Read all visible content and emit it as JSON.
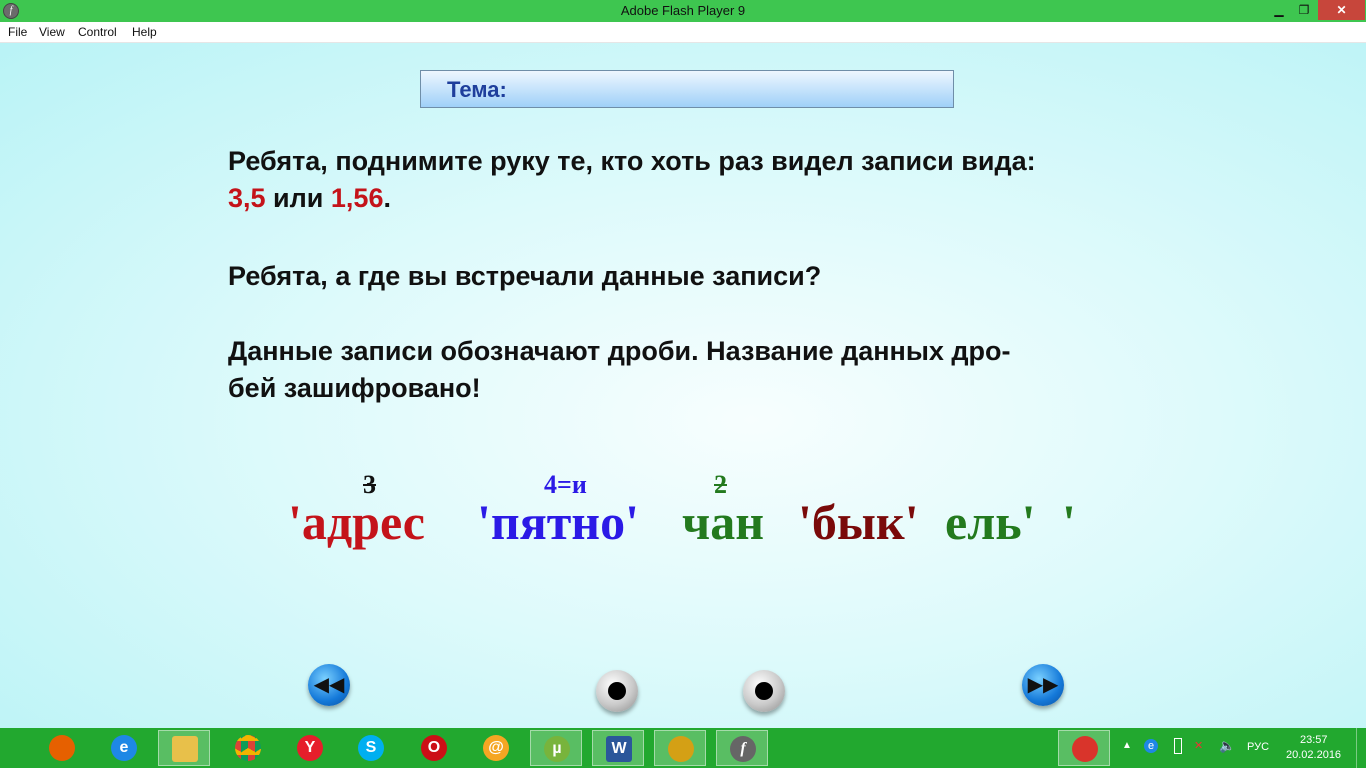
{
  "window": {
    "title": "Adobe Flash Player 9",
    "minimize_glyph": "▁",
    "maximize_glyph": "❐",
    "close_glyph": "✕"
  },
  "menu": [
    "File",
    "View",
    "Control",
    "Help"
  ],
  "slide": {
    "topic": "Тема:",
    "p1_line1": "Ребята, поднимите руку те, кто хоть раз видел записи вида:",
    "p1_num1": "3,5",
    "p1_mid": " или ",
    "p1_num2": "1,56",
    "p1_end": ".",
    "p2": "Ребята, а где вы встречали данные записи?",
    "p3_line1": "Данные записи обозначают дроби. Название данных дро-",
    "p3_line2": "бей зашифровано!",
    "cipher": {
      "w1": "'адрес",
      "w1_sup": "3",
      "w2": "'пятно'",
      "w2_sup": "4=и",
      "w3": "чан",
      "w3_sup": "2",
      "w4": "'бык'",
      "w5": "ель'",
      "w6": "'"
    },
    "colors": {
      "red": "#c4131a",
      "blue": "#2b1ae6",
      "green": "#237a1e",
      "darkred": "#7a0a0a"
    }
  },
  "nav": {
    "back_glyph": "◀◀",
    "forward_glyph": "▶▶"
  },
  "taskbar": {
    "apps": [
      {
        "name": "firefox-icon",
        "glyph": "",
        "color": "#e66000"
      },
      {
        "name": "internet-explorer-icon",
        "glyph": "e",
        "color": "#1e88e5"
      },
      {
        "name": "file-explorer-icon",
        "glyph": "",
        "color": "#e8c04a"
      },
      {
        "name": "chrome-icon",
        "glyph": "",
        "color": "#db4437"
      },
      {
        "name": "yandex-browser-icon",
        "glyph": "Y",
        "color": "#e61e2b"
      },
      {
        "name": "skype-icon",
        "glyph": "S",
        "color": "#00aff0"
      },
      {
        "name": "opera-icon",
        "glyph": "O",
        "color": "#cc0f16"
      },
      {
        "name": "mail-agent-icon",
        "glyph": "@",
        "color": "#f5a623"
      },
      {
        "name": "utorrent-icon",
        "glyph": "µ",
        "color": "#78b43c"
      },
      {
        "name": "word-icon",
        "glyph": "W",
        "color": "#2b579a"
      },
      {
        "name": "app-logo-icon",
        "glyph": "",
        "color": "#d4a015"
      },
      {
        "name": "flash-player-icon",
        "glyph": "f",
        "color": "#666666"
      }
    ],
    "tray": {
      "language": "РУС",
      "time": "23:57",
      "date": "20.02.2016"
    }
  }
}
